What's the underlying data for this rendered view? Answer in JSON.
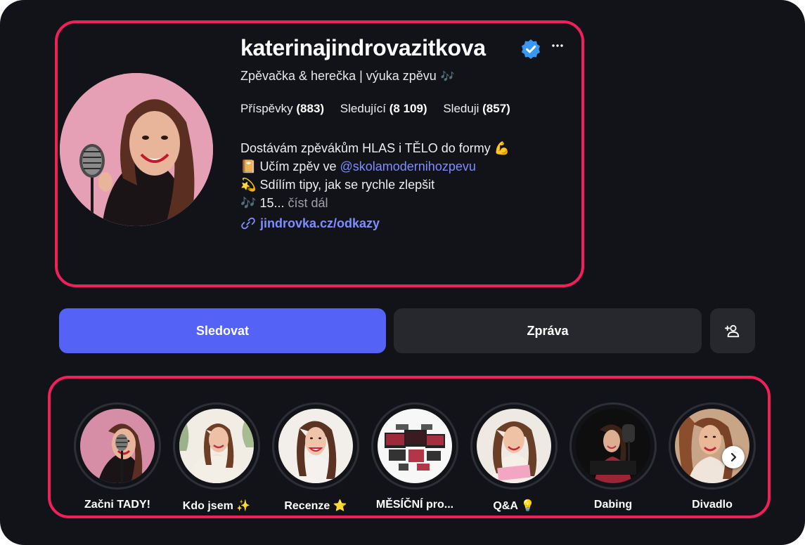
{
  "profile": {
    "username": "katerinajindrovazitkova",
    "verified": true,
    "category": "Zpěvačka & herečka | výuka zpěvu",
    "category_emoji": "🎶",
    "stats": {
      "posts_label": "Příspěvky",
      "posts_count": "(883)",
      "followers_label": "Sledující",
      "followers_count": "(8 109)",
      "following_label": "Sleduji",
      "following_count": "(857)"
    },
    "bio": {
      "line1_text": "Dostávám zpěvákům HLAS i TĚLO do formy",
      "line1_emoji": "💪",
      "line2_emoji": "📔",
      "line2_text": "Učím zpěv ve",
      "line2_mention": "@skolamodernihozpevu",
      "line3_emoji": "💫",
      "line3_text": "Sdílím tipy, jak se rychle zlepšit",
      "line4_emoji": "🎶",
      "line4_text": "15...",
      "read_more": "číst dál"
    },
    "link": "jindrovka.cz/odkazy"
  },
  "actions": {
    "follow_label": "Sledovat",
    "message_label": "Zpráva",
    "add_user_icon": "person-plus-icon"
  },
  "stories": [
    {
      "label": "Začni TADY!",
      "emoji": ""
    },
    {
      "label": "Kdo jsem",
      "emoji": "✨"
    },
    {
      "label": "Recenze",
      "emoji": "⭐"
    },
    {
      "label": "MĚSÍČNÍ pro...",
      "emoji": ""
    },
    {
      "label": "Q&A",
      "emoji": "💡"
    },
    {
      "label": "Dabing",
      "emoji": ""
    },
    {
      "label": "Divadlo",
      "emoji": ""
    }
  ],
  "colors": {
    "background": "#121318",
    "accent_button": "#5462f6",
    "secondary_button": "#26282e",
    "link": "#7e8dff",
    "highlight_border": "#f0205a",
    "verified_badge": "#3897f0"
  }
}
